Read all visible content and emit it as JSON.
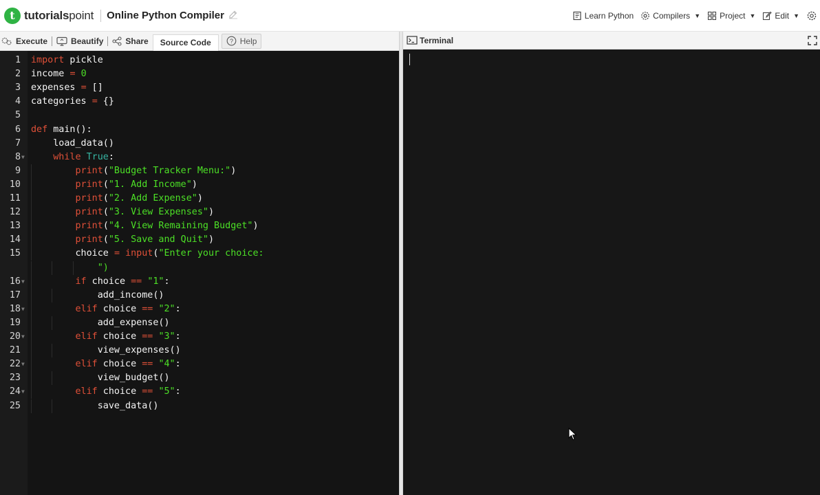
{
  "header": {
    "logo_text_bold": "tutorials",
    "logo_text_rest": "point",
    "page_title": "Online Python Compiler",
    "nav": [
      {
        "label": "Learn Python",
        "icon": "book-icon"
      },
      {
        "label": "Compilers",
        "icon": "gear-icon",
        "caret": true
      },
      {
        "label": "Project",
        "icon": "grid-icon",
        "caret": true
      },
      {
        "label": "Edit",
        "icon": "pencil-icon",
        "caret": true
      }
    ]
  },
  "toolbar": {
    "execute": "Execute",
    "beautify": "Beautify",
    "share": "Share",
    "source_code": "Source Code",
    "help": "Help"
  },
  "terminal": {
    "title": "Terminal"
  },
  "editor": {
    "lines": [
      "import pickle",
      "income = 0",
      "expenses = []",
      "categories = {}",
      "",
      "def main():",
      "    load_data()",
      "    while True:",
      "        print(\"Budget Tracker Menu:\")",
      "        print(\"1. Add Income\")",
      "        print(\"2. Add Expense\")",
      "        print(\"3. View Expenses\")",
      "        print(\"4. View Remaining Budget\")",
      "        print(\"5. Save and Quit\")",
      "        choice = input(\"Enter your choice: \")",
      "        if choice == \"1\":",
      "            add_income()",
      "        elif choice == \"2\":",
      "            add_expense()",
      "        elif choice == \"3\":",
      "            view_expenses()",
      "        elif choice == \"4\":",
      "            view_budget()",
      "        elif choice == \"5\":",
      "            save_data()"
    ]
  },
  "colors": {
    "keyword": "#e05038",
    "string": "#4ce026",
    "true_const": "#36b6a3",
    "editor_bg": "#141414",
    "logo_green": "#2fb344"
  }
}
